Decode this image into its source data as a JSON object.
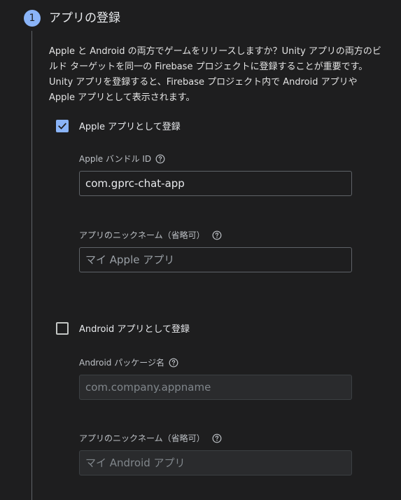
{
  "step": {
    "number": "1",
    "title": "アプリの登録"
  },
  "description": "Apple と Android の両方でゲームをリリースしますか？Unity アプリの両方のビルド ターゲットを同一の Firebase プロジェクトに登録することが重要です。Unity アプリを登録すると、Firebase プロジェクト内で Android アプリや Apple アプリとして表示されます。",
  "apple": {
    "checkbox_label": "Apple アプリとして登録",
    "checked": true,
    "bundle_label": "Apple バンドル ID",
    "bundle_value": "com.gprc-chat-app",
    "nickname_label": "アプリのニックネーム（省略可）",
    "nickname_placeholder": "マイ Apple アプリ"
  },
  "android": {
    "checkbox_label": "Android アプリとして登録",
    "checked": false,
    "package_label": "Android パッケージ名",
    "package_placeholder": "com.company.appname",
    "nickname_label": "アプリのニックネーム（省略可）",
    "nickname_placeholder": "マイ Android アプリ"
  },
  "colors": {
    "accent": "#8ab4f8",
    "background": "#1e1e1f"
  },
  "icons": {
    "help": "help-circle-icon",
    "check": "checkmark-icon"
  }
}
